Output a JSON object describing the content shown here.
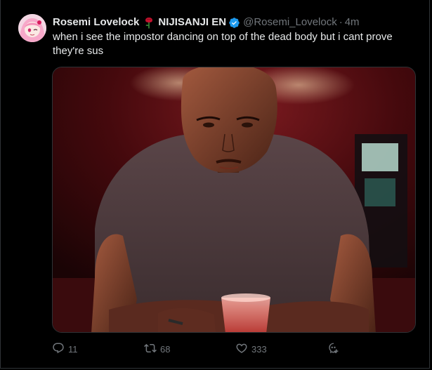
{
  "tweet": {
    "author_name": "Rosemi Lovelock",
    "org_name": "NIJISANJI EN",
    "handle": "@Rosemi_Lovelock",
    "separator": "·",
    "time": "4m",
    "text": "when i see the impostor dancing on top of the dead body but i cant prove they're sus"
  },
  "actions": {
    "reply_count": "11",
    "retweet_count": "68",
    "like_count": "333"
  },
  "colors": {
    "background": "#000000",
    "primary_text": "#e7e9ea",
    "secondary_text": "#71767b",
    "verified": "#1d9bf0",
    "rose": "#c4122d"
  },
  "icons": {
    "reply": "reply-icon",
    "retweet": "retweet-icon",
    "like": "heart-icon",
    "extra": "grok-icon",
    "verified": "verified-badge-icon",
    "emoji": "rose-icon"
  }
}
